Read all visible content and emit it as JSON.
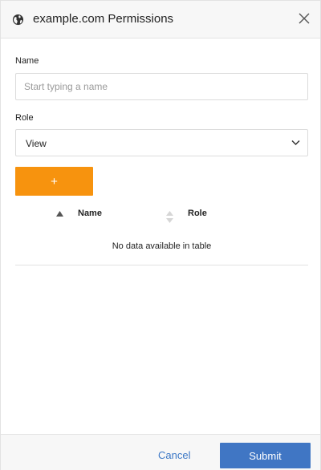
{
  "dialog": {
    "title": "example.com Permissions",
    "header_icon": "globe-icon",
    "close_icon": "close-icon"
  },
  "form": {
    "name_label": "Name",
    "name_placeholder": "Start typing a name",
    "name_value": "",
    "role_label": "Role",
    "role_value": "View",
    "role_icon": "chevron-down-icon",
    "add_label": "+"
  },
  "table": {
    "columns": [
      "Name",
      "Role"
    ],
    "sort_icons": [
      "sort-asc-icon",
      "sort-both-icon"
    ],
    "empty_message": "No data available in table"
  },
  "footer": {
    "cancel_label": "Cancel",
    "submit_label": "Submit"
  },
  "colors": {
    "add_button": "#f7930e",
    "submit_button": "#4076c4",
    "cancel_link": "#3c78c6"
  }
}
